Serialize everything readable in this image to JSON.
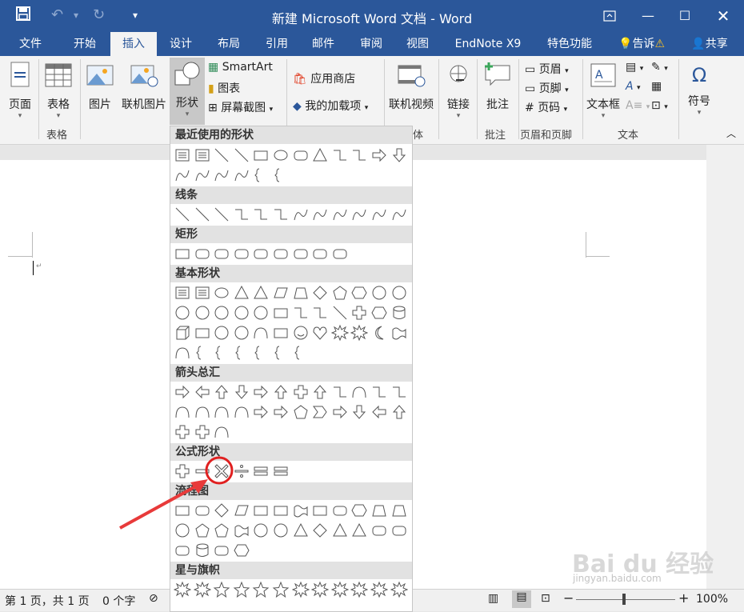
{
  "window": {
    "title": "新建 Microsoft Word 文档 - Word",
    "ribbon_display_icon": "ribbon-display-icon",
    "minimize_icon": "minimize-icon",
    "maximize_icon": "maximize-icon",
    "close_icon": "close-icon"
  },
  "qat": {
    "save_icon": "save-icon",
    "undo_icon": "undo-icon",
    "redo_icon": "redo-icon",
    "customize_icon": "customize-qat-icon"
  },
  "tabs": [
    "文件",
    "开始",
    "插入",
    "设计",
    "布局",
    "引用",
    "邮件",
    "审阅",
    "视图",
    "EndNote X9",
    "特色功能"
  ],
  "active_tab": "插入",
  "tell_me": "告诉",
  "share": "共享",
  "ribbon": {
    "page": "页面",
    "table": "表格",
    "picture": "图片",
    "online_picture": "联机图片",
    "shapes": "形状",
    "smartart": "SmartArt",
    "chart": "图表",
    "screenshot": "屏幕截图",
    "store": "应用商店",
    "my_addins": "我的加载项",
    "online_video": "联机视频",
    "link": "链接",
    "comment": "批注",
    "header": "页眉",
    "footer": "页脚",
    "page_number": "页码",
    "textbox": "文本框",
    "symbol": "符号",
    "groups": {
      "table": "表格",
      "media_tail": "体",
      "comments": "批注",
      "header_footer": "页眉和页脚",
      "text": "文本"
    }
  },
  "shapes_panel": {
    "recent": "最近使用的形状",
    "lines": "线条",
    "rectangles": "矩形",
    "basic": "基本形状",
    "arrows": "箭头总汇",
    "equation": "公式形状",
    "flowchart": "流程图",
    "stars": "星与旗帜"
  },
  "status": {
    "page": "第 1 页，共 1 页",
    "words": "0 个字",
    "zoom": "100%"
  },
  "watermark": {
    "brand": "Bai du 经验",
    "url": "jingyan.baidu.com"
  },
  "colors": {
    "word_blue": "#2b579a",
    "highlight": "#e02020",
    "arrow": "#e83a3a"
  }
}
